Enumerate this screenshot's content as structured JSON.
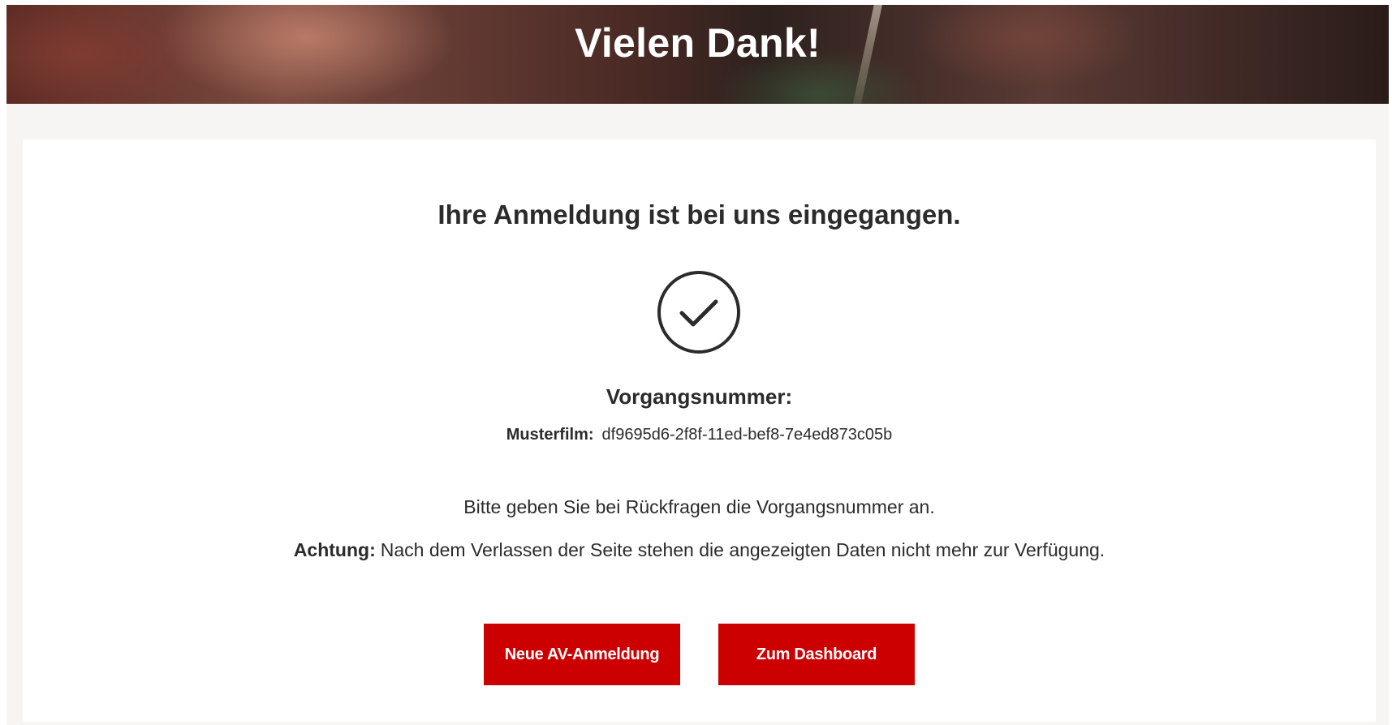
{
  "hero": {
    "title": "Vielen Dank!"
  },
  "confirmation": {
    "headline": "Ihre Anmeldung ist bei uns eingegangen.",
    "icon": "check-circle-icon",
    "reference_label": "Vorgangsnummer:",
    "reference_key": "Musterfilm:",
    "reference_value": "df9695d6-2f8f-11ed-bef8-7e4ed873c05b",
    "hint": "Bitte geben Sie bei Rückfragen die Vorgangsnummer an.",
    "warning_strong": "Achtung:",
    "warning_text": "Nach dem Verlassen der Seite stehen die angezeigten Daten nicht mehr zur Verfügung."
  },
  "actions": {
    "new_registration_label": "Neue AV-Anmeldung",
    "dashboard_label": "Zum Dashboard"
  },
  "colors": {
    "primary_button": "#cc0000",
    "text": "#2b2b2b",
    "page_background": "#f6f5f3"
  }
}
